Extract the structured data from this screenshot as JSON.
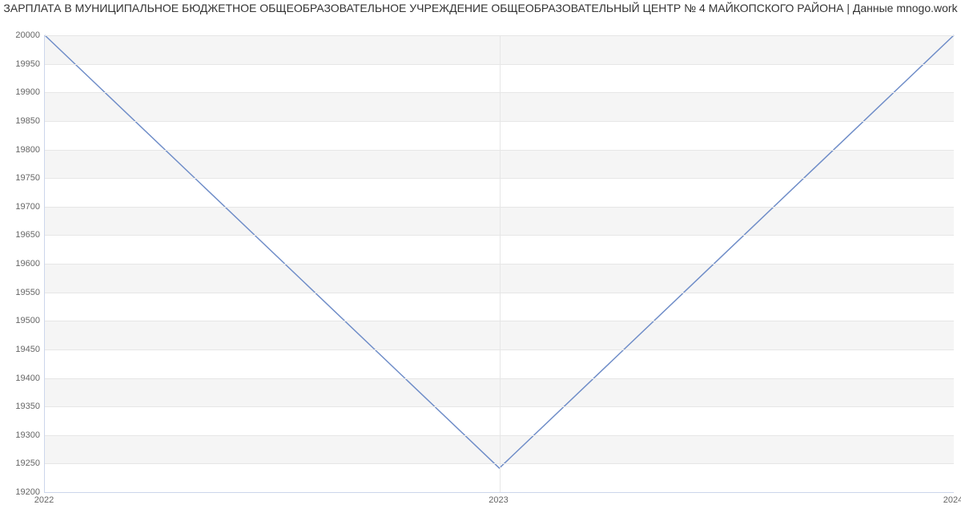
{
  "chart_data": {
    "type": "line",
    "title": "ЗАРПЛАТА В МУНИЦИПАЛЬНОЕ БЮДЖЕТНОЕ ОБЩЕОБРАЗОВАТЕЛЬНОЕ УЧРЕЖДЕНИЕ ОБЩЕОБРАЗОВАТЕЛЬНЫЙ ЦЕНТР № 4 МАЙКОПСКОГО РАЙОНА | Данные mnogo.work",
    "categories": [
      "2022",
      "2023",
      "2024"
    ],
    "values": [
      20000,
      19242,
      20000
    ],
    "xlabel": "",
    "ylabel": "",
    "ylim": [
      19200,
      20000
    ],
    "yticks": [
      19200,
      19250,
      19300,
      19350,
      19400,
      19450,
      19500,
      19550,
      19600,
      19650,
      19700,
      19750,
      19800,
      19850,
      19900,
      19950,
      20000
    ],
    "line_color": "#6f8dc8"
  }
}
